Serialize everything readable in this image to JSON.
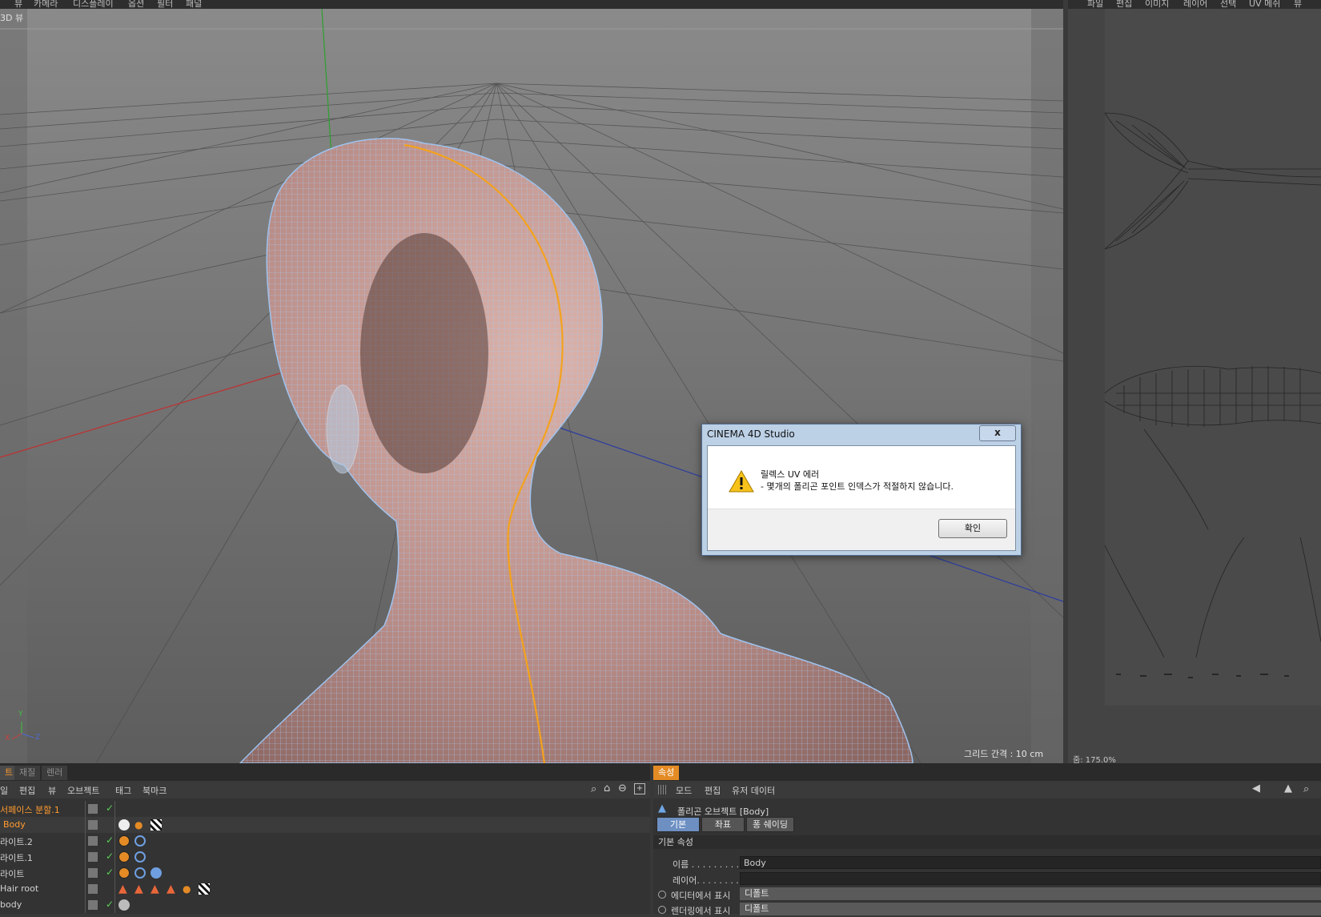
{
  "menubar": {
    "items": [
      "뷰",
      "카메라",
      "디스플레이",
      "옵션",
      "필터",
      "패널"
    ]
  },
  "viewport": {
    "label": "3D 뷰",
    "grid_info": "그리드 간격 : 10 cm",
    "axis_labels": {
      "y": "Y",
      "x": "X",
      "z": "Z"
    }
  },
  "uv_editor": {
    "menu": [
      "파일",
      "편집",
      "이미지",
      "레이어",
      "선택",
      "UV 메쉬",
      "뷰"
    ],
    "zoom": "줌: 175.0%"
  },
  "object_manager": {
    "tabs": [
      "트",
      "재질",
      "렌러"
    ],
    "menu": [
      "일",
      "편집",
      "뷰",
      "오브젝트",
      "태그",
      "북마크"
    ],
    "rows": [
      {
        "name": "서페이스 분할.1",
        "selected": true
      },
      {
        "name": "Body",
        "selected": true
      },
      {
        "name": "라이트.2",
        "selected": false
      },
      {
        "name": "라이트.1",
        "selected": false
      },
      {
        "name": "라이트",
        "selected": false
      },
      {
        "name": "Hair root",
        "selected": false
      },
      {
        "name": "body",
        "selected": false
      }
    ]
  },
  "attributes": {
    "tab": "속성",
    "menu": [
      "모드",
      "편집",
      "유저 데이터"
    ],
    "object_title": "폴리곤 오브젝트 [Body]",
    "tabs": [
      "기본",
      "좌표",
      "퐁 쉐이딩"
    ],
    "active_tab": "기본",
    "section": "기본 속성",
    "fields": {
      "name_label": "이름 . . . . . . . . .",
      "name_value": "Body",
      "layer_label": "레이어. . . . . . . .",
      "layer_value": "",
      "editor_label": "에디터에서 표시",
      "editor_value": "디폴트",
      "render_label": "렌더링에서 표시",
      "render_value": "디폴트"
    }
  },
  "dialog": {
    "title": "CINEMA 4D Studio",
    "close": "x",
    "line1": "릴렉스 UV 에러",
    "line2": "- 몇개의 폴리곤 포인트 인덱스가 적절하지 않습니다.",
    "ok": "확인"
  },
  "colors": {
    "accent_orange": "#e48b25",
    "skin": "#c9a19a",
    "wire": "#9fc3ef",
    "seam": "#f4a21c"
  }
}
